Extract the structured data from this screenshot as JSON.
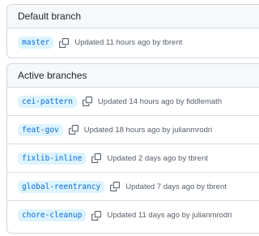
{
  "default_section": {
    "title": "Default branch",
    "branches": [
      {
        "name": "master",
        "updated": "Updated 11 hours ago by",
        "author": "tbrent"
      }
    ]
  },
  "active_section": {
    "title": "Active branches",
    "branches": [
      {
        "name": "cei-pattern",
        "updated": "Updated 14 hours ago by",
        "author": "fiddlemath"
      },
      {
        "name": "feat-gov",
        "updated": "Updated 18 hours ago by",
        "author": "julianmrodri"
      },
      {
        "name": "fixlib-inline",
        "updated": "Updated 2 days ago by",
        "author": "tbrent"
      },
      {
        "name": "global-reentrancy",
        "updated": "Updated 7 days ago by",
        "author": "tbrent"
      },
      {
        "name": "chore-cleanup",
        "updated": "Updated 11 days ago by",
        "author": "julianmrodri"
      }
    ]
  },
  "icons": {
    "copy": "copy-icon"
  },
  "colors": {
    "branch_text": "#0969da",
    "branch_bg": "#ddf4ff",
    "muted_text": "#57606a",
    "border": "#d0d7de",
    "header_bg": "#f6f8fa"
  }
}
